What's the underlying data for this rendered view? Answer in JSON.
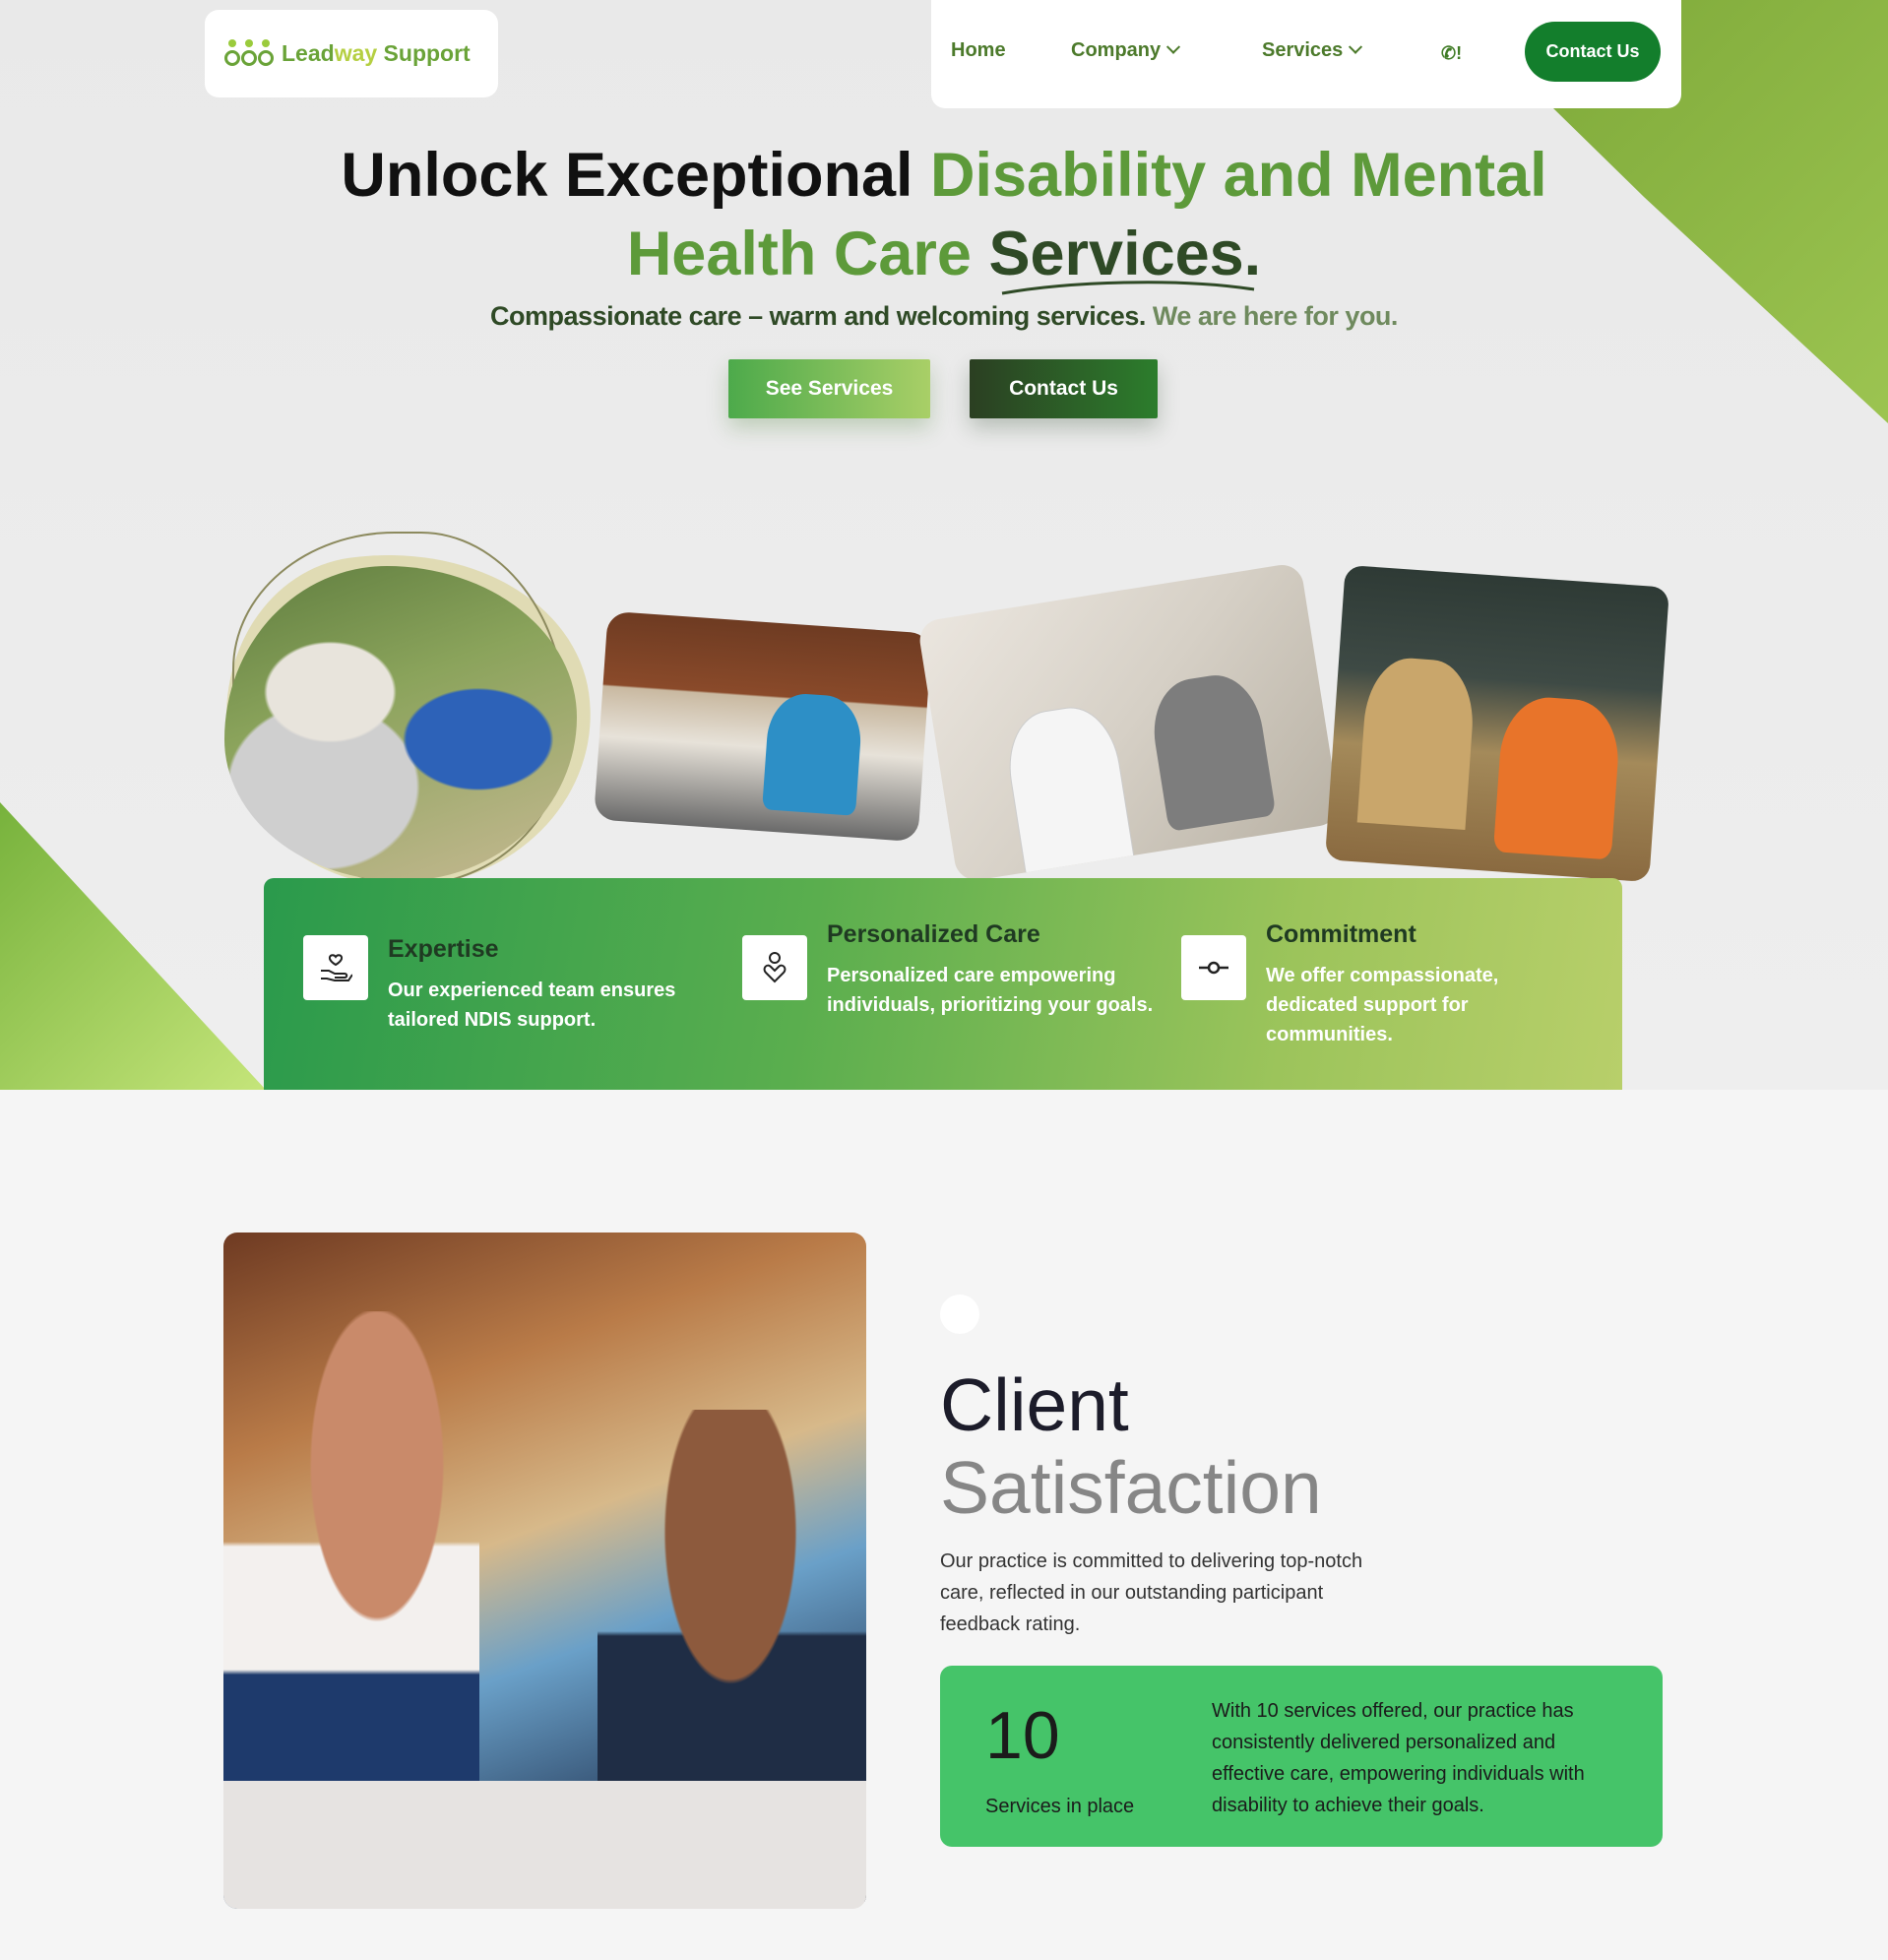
{
  "brand": {
    "logo_main": "Lead",
    "logo_accent": "way",
    "logo_rest": " Support"
  },
  "nav": {
    "items": [
      {
        "label": "Home"
      },
      {
        "label": "Company"
      },
      {
        "label": "Services"
      }
    ],
    "phone_glyph": "!",
    "cta_label": "Contact Us"
  },
  "hero": {
    "title_black": "Unlock Exceptional ",
    "title_green_1": "Disability and Mental",
    "title_green_2": "Health Care ",
    "title_dark": "Services.",
    "subtitle_strong": "Compassionate care – warm and welcoming services.",
    "subtitle_soft": " We are here for you.",
    "btn_services": "See Services",
    "btn_contact": "Contact Us"
  },
  "features": [
    {
      "icon": "hand-heart-icon",
      "title": "Expertise",
      "desc": "Our experienced team ensures tailored NDIS support."
    },
    {
      "icon": "person-heart-icon",
      "title": "Personalized Care",
      "desc": "Personalized care empowering individuals, prioritizing your goals."
    },
    {
      "icon": "commit-icon",
      "title": "Commitment",
      "desc": "We offer compassionate, dedicated support for communities."
    }
  ],
  "satisfaction": {
    "title_1": "Client",
    "title_2": "Satisfaction",
    "desc": "Our practice is committed to delivering top-notch care, reflected in our outstanding participant feedback rating.",
    "stat_number": "10",
    "stat_label": "Services in place",
    "stat_text": "With 10 services offered, our practice has consistently delivered personalized and effective care, empowering individuals with disability to achieve their goals."
  },
  "colors": {
    "brand_green": "#6aa338",
    "dark_green": "#137e2c",
    "stat_card": "#45c469"
  }
}
